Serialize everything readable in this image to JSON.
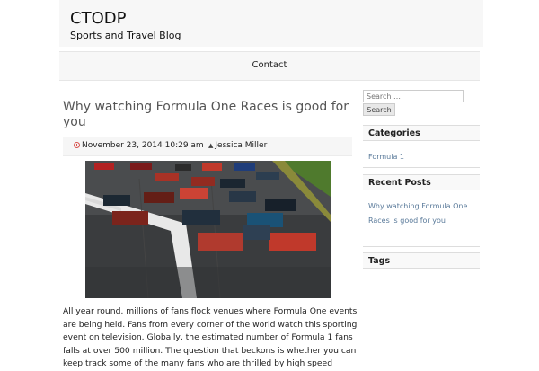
{
  "site": {
    "title": "CTODP",
    "description": "Sports and Travel Blog"
  },
  "nav": {
    "items": [
      "Contact"
    ]
  },
  "post": {
    "title": "Why watching Formula One Races is good for you",
    "date": "November 23, 2014 10:29 am",
    "author": "Jessica Miller",
    "excerpt": "All year round, millions of fans flock venues where Formula One events are being held. Fans from every corner of the world watch this sporting event on television. Globally, the estimated number of Formula 1 fans falls at over 500 million. The question that beckons is whether you can keep track some of the many fans who are thrilled by high speed"
  },
  "sidebar": {
    "search": {
      "placeholder": "Search …",
      "button": "Search"
    },
    "categories": {
      "title": "Categories",
      "items": [
        "Formula 1"
      ]
    },
    "recent_posts": {
      "title": "Recent Posts",
      "items": [
        "Why watching Formula One Races is good for you"
      ]
    },
    "tags": {
      "title": "Tags"
    }
  },
  "colors": {
    "link": "#5a7a9a",
    "accent": "#d9534f",
    "header_bg": "#f7f7f7"
  }
}
